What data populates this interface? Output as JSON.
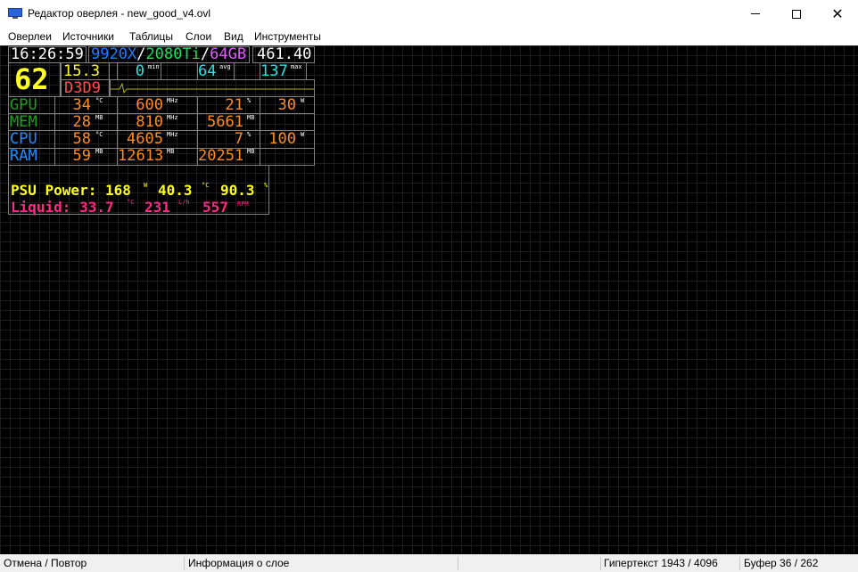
{
  "window": {
    "title": "Редактор оверлея - new_good_v4.ovl",
    "controls": {
      "minimize": "",
      "maximize": "",
      "close": "✕"
    }
  },
  "menu": {
    "items": [
      "Оверлеи",
      "Источники",
      "Таблицы",
      "Слои",
      "Вид",
      "Инструменты"
    ]
  },
  "overlay": {
    "clock": "16:26:59",
    "cpu_model": "9920X",
    "sep1": "/",
    "gpu_model": "2080Ti",
    "sep2": "/",
    "ram_size": "64GB",
    "frametime_total": "461.40",
    "fps": "62",
    "frametime": "15.3",
    "api": "D3D9",
    "fps_min": "0",
    "fps_min_unit": "min",
    "fps_avg": "64",
    "fps_avg_unit": "avg",
    "fps_max": "137",
    "fps_max_unit": "max",
    "rows": [
      {
        "label": "GPU",
        "c1": "34",
        "u1": "°C",
        "c2": "600",
        "u2": "MHz",
        "c3": "21",
        "u3": "%",
        "c4": "30",
        "u4": "W"
      },
      {
        "label": "MEM",
        "c1": "28",
        "u1": "MB",
        "c2": "810",
        "u2": "MHz",
        "c3": "5661",
        "u3": "MB",
        "c4": "",
        "u4": ""
      },
      {
        "label": "CPU",
        "c1": "58",
        "u1": "°C",
        "c2": "4605",
        "u2": "MHz",
        "c3": "7",
        "u3": "%",
        "c4": "100",
        "u4": "W"
      },
      {
        "label": "RAM",
        "c1": "59",
        "u1": "MB",
        "c2": "12613",
        "u2": "MB",
        "c3": "20251",
        "u3": "MB",
        "c4": "",
        "u4": ""
      }
    ],
    "psu": {
      "label": "PSU Power:",
      "power": "168",
      "power_unit": "W",
      "temp": "40.3",
      "temp_unit": "°C",
      "load": "90.3",
      "load_unit": "%"
    },
    "liquid": {
      "label": "Liquid:",
      "temp": "33.7",
      "temp_unit": "°C",
      "flow": "231",
      "flow_unit": "L/h",
      "rpm": "557",
      "rpm_unit": "RPM"
    },
    "colors": {
      "white": "#ffffff",
      "blue": "#1e7cff",
      "green": "#19e05a",
      "magenta": "#e05cff",
      "yellow": "#ffff1e",
      "red": "#ff4e4e",
      "cyan": "#1ee6e6",
      "orange": "#ff8c1e",
      "gpu_label": "#1aa01a",
      "cpu_label": "#1e8cff",
      "liquid": "#ff2a86",
      "graph": "#b4b41e"
    }
  },
  "statusbar": {
    "undo_redo": "Отмена / Повтор",
    "layer_info": "Информация о слое",
    "hypertext": "Гипертекст 1943 / 4096",
    "buffer": "Буфер 36 / 262"
  }
}
